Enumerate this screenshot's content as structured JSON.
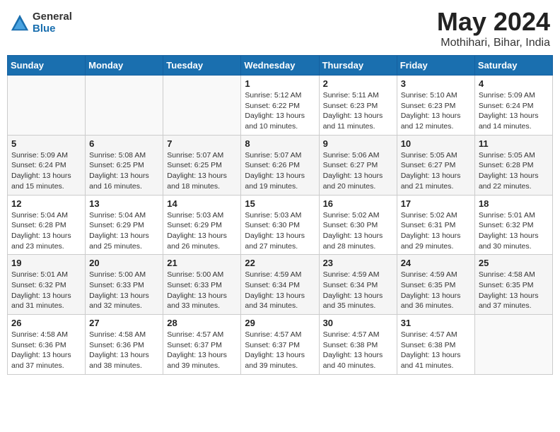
{
  "header": {
    "logo_general": "General",
    "logo_blue": "Blue",
    "month_year": "May 2024",
    "location": "Mothihari, Bihar, India"
  },
  "days_of_week": [
    "Sunday",
    "Monday",
    "Tuesday",
    "Wednesday",
    "Thursday",
    "Friday",
    "Saturday"
  ],
  "weeks": [
    [
      {
        "day": "",
        "info": ""
      },
      {
        "day": "",
        "info": ""
      },
      {
        "day": "",
        "info": ""
      },
      {
        "day": "1",
        "info": "Sunrise: 5:12 AM\nSunset: 6:22 PM\nDaylight: 13 hours\nand 10 minutes."
      },
      {
        "day": "2",
        "info": "Sunrise: 5:11 AM\nSunset: 6:23 PM\nDaylight: 13 hours\nand 11 minutes."
      },
      {
        "day": "3",
        "info": "Sunrise: 5:10 AM\nSunset: 6:23 PM\nDaylight: 13 hours\nand 12 minutes."
      },
      {
        "day": "4",
        "info": "Sunrise: 5:09 AM\nSunset: 6:24 PM\nDaylight: 13 hours\nand 14 minutes."
      }
    ],
    [
      {
        "day": "5",
        "info": "Sunrise: 5:09 AM\nSunset: 6:24 PM\nDaylight: 13 hours\nand 15 minutes."
      },
      {
        "day": "6",
        "info": "Sunrise: 5:08 AM\nSunset: 6:25 PM\nDaylight: 13 hours\nand 16 minutes."
      },
      {
        "day": "7",
        "info": "Sunrise: 5:07 AM\nSunset: 6:25 PM\nDaylight: 13 hours\nand 18 minutes."
      },
      {
        "day": "8",
        "info": "Sunrise: 5:07 AM\nSunset: 6:26 PM\nDaylight: 13 hours\nand 19 minutes."
      },
      {
        "day": "9",
        "info": "Sunrise: 5:06 AM\nSunset: 6:27 PM\nDaylight: 13 hours\nand 20 minutes."
      },
      {
        "day": "10",
        "info": "Sunrise: 5:05 AM\nSunset: 6:27 PM\nDaylight: 13 hours\nand 21 minutes."
      },
      {
        "day": "11",
        "info": "Sunrise: 5:05 AM\nSunset: 6:28 PM\nDaylight: 13 hours\nand 22 minutes."
      }
    ],
    [
      {
        "day": "12",
        "info": "Sunrise: 5:04 AM\nSunset: 6:28 PM\nDaylight: 13 hours\nand 23 minutes."
      },
      {
        "day": "13",
        "info": "Sunrise: 5:04 AM\nSunset: 6:29 PM\nDaylight: 13 hours\nand 25 minutes."
      },
      {
        "day": "14",
        "info": "Sunrise: 5:03 AM\nSunset: 6:29 PM\nDaylight: 13 hours\nand 26 minutes."
      },
      {
        "day": "15",
        "info": "Sunrise: 5:03 AM\nSunset: 6:30 PM\nDaylight: 13 hours\nand 27 minutes."
      },
      {
        "day": "16",
        "info": "Sunrise: 5:02 AM\nSunset: 6:30 PM\nDaylight: 13 hours\nand 28 minutes."
      },
      {
        "day": "17",
        "info": "Sunrise: 5:02 AM\nSunset: 6:31 PM\nDaylight: 13 hours\nand 29 minutes."
      },
      {
        "day": "18",
        "info": "Sunrise: 5:01 AM\nSunset: 6:32 PM\nDaylight: 13 hours\nand 30 minutes."
      }
    ],
    [
      {
        "day": "19",
        "info": "Sunrise: 5:01 AM\nSunset: 6:32 PM\nDaylight: 13 hours\nand 31 minutes."
      },
      {
        "day": "20",
        "info": "Sunrise: 5:00 AM\nSunset: 6:33 PM\nDaylight: 13 hours\nand 32 minutes."
      },
      {
        "day": "21",
        "info": "Sunrise: 5:00 AM\nSunset: 6:33 PM\nDaylight: 13 hours\nand 33 minutes."
      },
      {
        "day": "22",
        "info": "Sunrise: 4:59 AM\nSunset: 6:34 PM\nDaylight: 13 hours\nand 34 minutes."
      },
      {
        "day": "23",
        "info": "Sunrise: 4:59 AM\nSunset: 6:34 PM\nDaylight: 13 hours\nand 35 minutes."
      },
      {
        "day": "24",
        "info": "Sunrise: 4:59 AM\nSunset: 6:35 PM\nDaylight: 13 hours\nand 36 minutes."
      },
      {
        "day": "25",
        "info": "Sunrise: 4:58 AM\nSunset: 6:35 PM\nDaylight: 13 hours\nand 37 minutes."
      }
    ],
    [
      {
        "day": "26",
        "info": "Sunrise: 4:58 AM\nSunset: 6:36 PM\nDaylight: 13 hours\nand 37 minutes."
      },
      {
        "day": "27",
        "info": "Sunrise: 4:58 AM\nSunset: 6:36 PM\nDaylight: 13 hours\nand 38 minutes."
      },
      {
        "day": "28",
        "info": "Sunrise: 4:57 AM\nSunset: 6:37 PM\nDaylight: 13 hours\nand 39 minutes."
      },
      {
        "day": "29",
        "info": "Sunrise: 4:57 AM\nSunset: 6:37 PM\nDaylight: 13 hours\nand 39 minutes."
      },
      {
        "day": "30",
        "info": "Sunrise: 4:57 AM\nSunset: 6:38 PM\nDaylight: 13 hours\nand 40 minutes."
      },
      {
        "day": "31",
        "info": "Sunrise: 4:57 AM\nSunset: 6:38 PM\nDaylight: 13 hours\nand 41 minutes."
      },
      {
        "day": "",
        "info": ""
      }
    ]
  ]
}
